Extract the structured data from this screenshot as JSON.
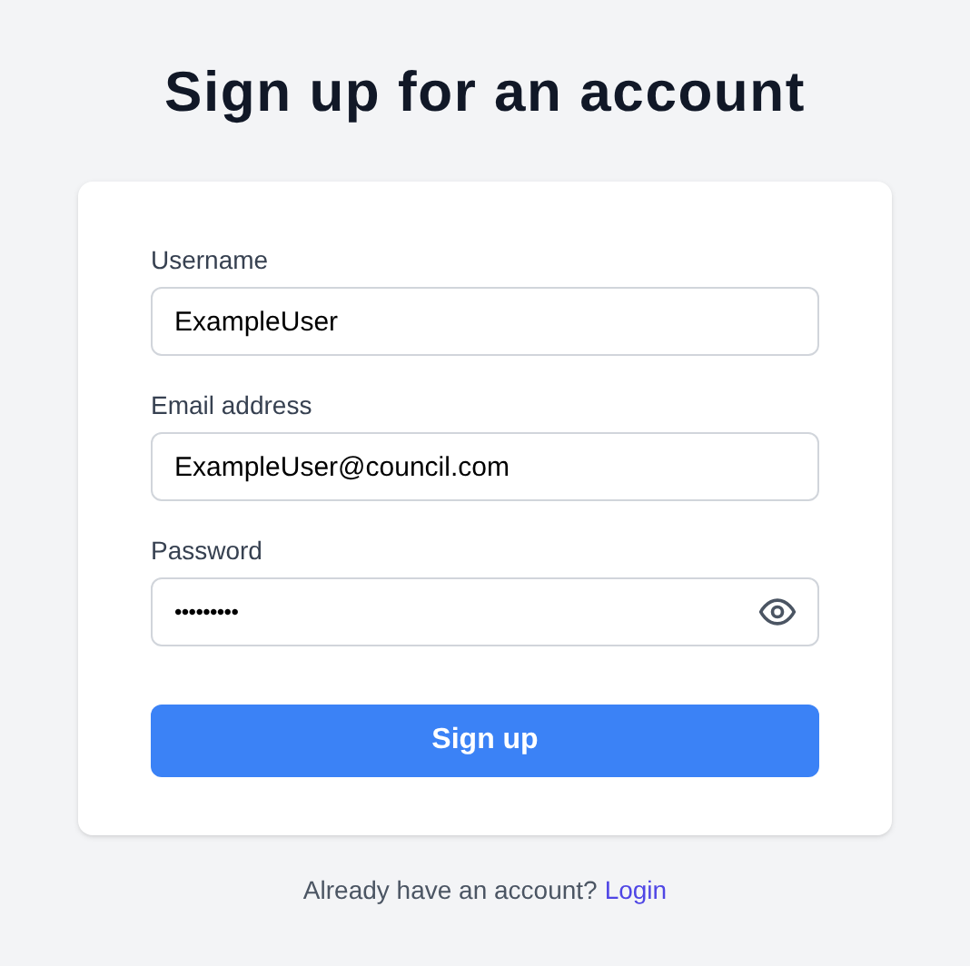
{
  "title": "Sign up for an account",
  "fields": [
    {
      "label": "Username",
      "value": "ExampleUser",
      "kind": "text"
    },
    {
      "label": "Email address",
      "value": "ExampleUser@council.com",
      "kind": "text"
    },
    {
      "label": "Password",
      "value": "•••••••••",
      "kind": "password"
    }
  ],
  "submit": "Sign up",
  "footer": {
    "text": "Already have an account?",
    "link": "Login"
  }
}
